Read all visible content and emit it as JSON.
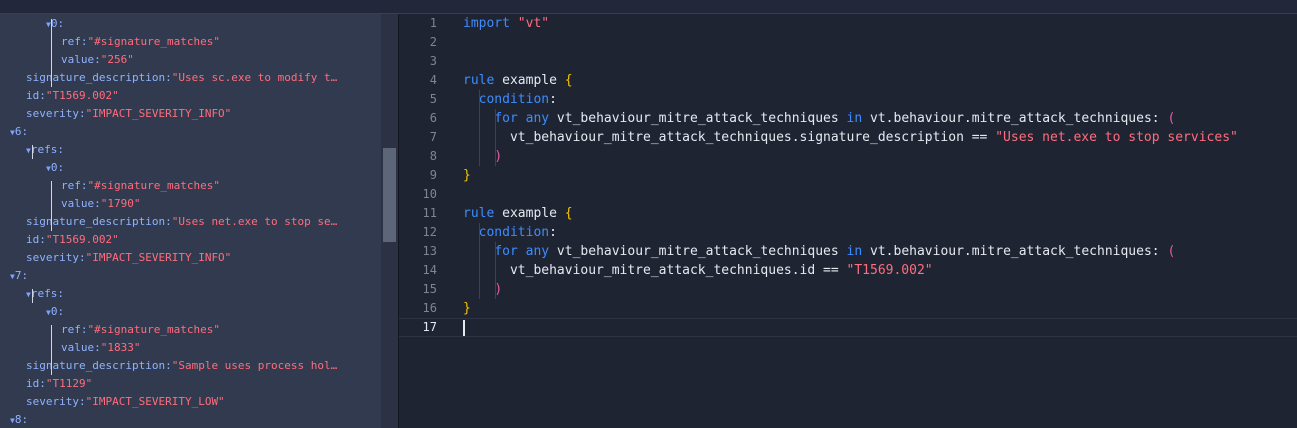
{
  "tree": [
    {
      "indent": 2,
      "caret": "▼",
      "key": "0",
      "sep": ":",
      "value": ""
    },
    {
      "indent": 3,
      "caret": "",
      "key": "ref",
      "sep": ":",
      "value": "\"#signature_matches\""
    },
    {
      "indent": 3,
      "caret": "",
      "key": "value",
      "sep": ":",
      "value": "\"256\""
    },
    {
      "indent": 1,
      "caret": "",
      "key": "signature_description",
      "sep": ":",
      "value": "\"Uses sc.exe to modify t…"
    },
    {
      "indent": 1,
      "caret": "",
      "key": "id",
      "sep": ":",
      "value": "\"T1569.002\""
    },
    {
      "indent": 1,
      "caret": "",
      "key": "severity",
      "sep": ":",
      "value": "\"IMPACT_SEVERITY_INFO\""
    },
    {
      "indent": 0,
      "caret": "▼",
      "key": "6",
      "sep": ":",
      "value": ""
    },
    {
      "indent": 1,
      "caret": "▼",
      "key": "refs",
      "sep": ":",
      "value": ""
    },
    {
      "indent": 2,
      "caret": "▼",
      "key": "0",
      "sep": ":",
      "value": ""
    },
    {
      "indent": 3,
      "caret": "",
      "key": "ref",
      "sep": ":",
      "value": "\"#signature_matches\""
    },
    {
      "indent": 3,
      "caret": "",
      "key": "value",
      "sep": ":",
      "value": "\"1790\""
    },
    {
      "indent": 1,
      "caret": "",
      "key": "signature_description",
      "sep": ":",
      "value": "\"Uses net.exe to stop se…"
    },
    {
      "indent": 1,
      "caret": "",
      "key": "id",
      "sep": ":",
      "value": "\"T1569.002\""
    },
    {
      "indent": 1,
      "caret": "",
      "key": "severity",
      "sep": ":",
      "value": "\"IMPACT_SEVERITY_INFO\""
    },
    {
      "indent": 0,
      "caret": "▼",
      "key": "7",
      "sep": ":",
      "value": ""
    },
    {
      "indent": 1,
      "caret": "▼",
      "key": "refs",
      "sep": ":",
      "value": ""
    },
    {
      "indent": 2,
      "caret": "▼",
      "key": "0",
      "sep": ":",
      "value": ""
    },
    {
      "indent": 3,
      "caret": "",
      "key": "ref",
      "sep": ":",
      "value": "\"#signature_matches\""
    },
    {
      "indent": 3,
      "caret": "",
      "key": "value",
      "sep": ":",
      "value": "\"1833\""
    },
    {
      "indent": 1,
      "caret": "",
      "key": "signature_description",
      "sep": ":",
      "value": "\"Sample uses process hol…"
    },
    {
      "indent": 1,
      "caret": "",
      "key": "id",
      "sep": ":",
      "value": "\"T1129\""
    },
    {
      "indent": 1,
      "caret": "",
      "key": "severity",
      "sep": ":",
      "value": "\"IMPACT_SEVERITY_LOW\""
    },
    {
      "indent": 0,
      "caret": "▼",
      "key": "8",
      "sep": ":",
      "value": ""
    }
  ],
  "editor": {
    "line_numbers": [
      "1",
      "2",
      "3",
      "4",
      "5",
      "6",
      "7",
      "8",
      "9",
      "10",
      "11",
      "12",
      "13",
      "14",
      "15",
      "16",
      "17"
    ],
    "active_line": 17,
    "lines": [
      [
        {
          "t": "kw",
          "v": "import"
        },
        {
          "t": "id",
          "v": " "
        },
        {
          "t": "s",
          "v": "\"vt\""
        }
      ],
      [],
      [],
      [
        {
          "t": "kw",
          "v": "rule"
        },
        {
          "t": "id",
          "v": " example "
        },
        {
          "t": "brace",
          "v": "{"
        }
      ],
      [
        {
          "t": "id",
          "v": "  "
        },
        {
          "t": "kw",
          "v": "condition"
        },
        {
          "t": "id",
          "v": ":"
        }
      ],
      [
        {
          "t": "id",
          "v": "    "
        },
        {
          "t": "kw",
          "v": "for any"
        },
        {
          "t": "id",
          "v": " vt_behaviour_mitre_attack_techniques "
        },
        {
          "t": "kw",
          "v": "in"
        },
        {
          "t": "id",
          "v": " vt.behaviour.mitre_attack_techniques: "
        },
        {
          "t": "paren",
          "v": "("
        }
      ],
      [
        {
          "t": "id",
          "v": "      vt_behaviour_mitre_attack_techniques.signature_description == "
        },
        {
          "t": "s",
          "v": "\"Uses net.exe to stop services\""
        }
      ],
      [
        {
          "t": "id",
          "v": "    "
        },
        {
          "t": "paren",
          "v": ")"
        }
      ],
      [
        {
          "t": "brace",
          "v": "}"
        }
      ],
      [],
      [
        {
          "t": "kw",
          "v": "rule"
        },
        {
          "t": "id",
          "v": " example "
        },
        {
          "t": "brace",
          "v": "{"
        }
      ],
      [
        {
          "t": "id",
          "v": "  "
        },
        {
          "t": "kw",
          "v": "condition"
        },
        {
          "t": "id",
          "v": ":"
        }
      ],
      [
        {
          "t": "id",
          "v": "    "
        },
        {
          "t": "kw",
          "v": "for any"
        },
        {
          "t": "id",
          "v": " vt_behaviour_mitre_attack_techniques "
        },
        {
          "t": "kw",
          "v": "in"
        },
        {
          "t": "id",
          "v": " vt.behaviour.mitre_attack_techniques: "
        },
        {
          "t": "paren",
          "v": "("
        }
      ],
      [
        {
          "t": "id",
          "v": "      vt_behaviour_mitre_attack_techniques.id == "
        },
        {
          "t": "s",
          "v": "\"T1569.002\""
        }
      ],
      [
        {
          "t": "id",
          "v": "    "
        },
        {
          "t": "paren",
          "v": ")"
        }
      ],
      [
        {
          "t": "brace",
          "v": "}"
        }
      ],
      []
    ]
  }
}
